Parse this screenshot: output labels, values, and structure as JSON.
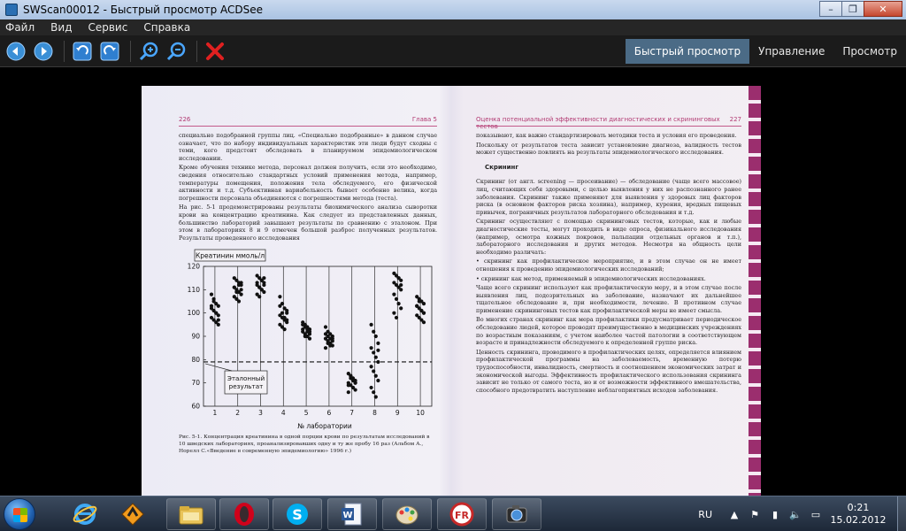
{
  "window": {
    "title": "SWScan00012 - Быстрый просмотр ACDSee",
    "minimize": "–",
    "restore": "❐",
    "close": "✕"
  },
  "menu": [
    "Файл",
    "Вид",
    "Сервис",
    "Справка"
  ],
  "toolbar": {
    "icons": [
      "back-arrow-icon",
      "forward-arrow-icon",
      "rotate-left-icon",
      "rotate-right-icon",
      "zoom-in-icon",
      "zoom-out-icon",
      "delete-icon"
    ]
  },
  "modes": [
    "Быстрый просмотр",
    "Управление",
    "Просмотр"
  ],
  "scan": {
    "left_page": {
      "page_number": "226",
      "chapter": "Глава 5",
      "paragraphs": [
        "специально подобранной группы лиц. «Специально подобранные» в данном случае означает, что по набору индивидуальных характеристик эти люди будут сходны с теми, кого предстоит обследовать в планируемом эпидемиологическом исследовании.",
        "Кроме обучения технике метода, персонал должен получить, если это необходимо, сведения относительно стандартных условий применения метода, например, температуры помещения, положения тела обследуемого, его физической активности и т.д. Субъективная вариабельность бывает особенно велика, когда погрешности персонала объединяются с погрешностями метода (теста).",
        "На рис. 5-1 продемонстрированы результаты биохимического анализа сыворотки крови на концентрацию креатинина. Как следует из представленных данных, большинство лабораторий завышают результаты по сравнению с эталоном. При этом в лабораториях 8 и 9 отмечен большой разброс полученных результатов. Результаты проведенного исследования"
      ],
      "caption": "Рис. 5-1. Концентрация креатинина в одной порции крови по результатам исследований в 10 шведских лабораториях, проанализировавших одну и ту же пробу 16 раз (Альбом А., Норелл С.«Введение в современную эпидемиологию» 1996 г.)"
    },
    "right_page": {
      "page_number": "227",
      "header": "Оценка потенциальной эффективности диагностических и скрининговых тестов",
      "intro": [
        "показывают, как важно стандартизировать методики теста и условия его проведения.",
        "Поскольку от результатов теста зависит установление диагноза, валидность тестов может существенно повлиять на результаты эпидемиологического исследования."
      ],
      "section_title": "Скрининг",
      "body": [
        "Скрининг (от англ. screening — просеивание) — обследование (чаще всего массовое) лиц, считающих себя здоровыми, с целью выявления у них не распознанного ранее заболевания. Скрининг также применяют для выявления у здоровых лиц факторов риска (в основном факторов риска хозяина), например, курения, вредных пищевых привычек, пограничных результатов лабораторного обследования и т.д.",
        "Скрининг осуществляют с помощью скрининговых тестов, которые, как и любые диагностические тесты, могут проходить в виде опроса, физикального исследования (например, осмотра кожных покровов, пальпации отдельных органов и т.п.), лабораторного исследования и других методов. Несмотря на общность цели необходимо различать:",
        "• скрининг как профилактическое мероприятие, и в этом случае он не имеет отношения к проведению эпидемиологических исследований;",
        "• скрининг как метод, применяемый в эпидемиологических исследованиях.",
        "Чаще всего скрининг используют как профилактическую меру, и в этом случае после выявления лиц, подозрительных на заболевание, назначают их дальнейшее тщательное обследование и, при необходимости, лечение. В противном случае применение скрининговых тестов как профилактической меры не имеет смысла.",
        "Во многих странах скрининг как мера профилактики предусматривает периодическое обследование людей, которое проводят преимущественно в медицинских учреждениях по возрастным показаниям, с учетом наиболее частой патологии в соответствующем возрасте и принадлежности обследуемого к определенной группе риска.",
        "Ценность скрининга, проводимого в профилактических целях, определяется влиянием профилактической программы на заболеваемость, временную потерю трудоспособности, инвалидность, смертность и соотношением экономических затрат и экономической выгоды. Эффективность профилактического использования скрининга зависит не только от самого теста, но и от возможности эффективного вмешательства, способного предотвратить наступление неблагоприятных исходов заболевания."
      ]
    }
  },
  "chart_data": {
    "type": "scatter",
    "ylabel": "Креатинин ммоль/л",
    "xlabel": "№ лаборатории",
    "ylim": [
      60,
      120
    ],
    "yticks": [
      60,
      70,
      80,
      90,
      100,
      110,
      120
    ],
    "categories": [
      "1",
      "2",
      "3",
      "4",
      "5",
      "6",
      "7",
      "8",
      "9",
      "10"
    ],
    "reference_value": 79,
    "reference_label": "Эталонный результат",
    "series": [
      {
        "values": [
          108,
          106,
          104,
          103,
          102,
          101,
          100,
          99,
          98,
          97,
          96,
          95,
          103,
          105,
          100,
          97
        ]
      },
      {
        "values": [
          115,
          114,
          113,
          112,
          111,
          110,
          109,
          108,
          107,
          106,
          105,
          113,
          111,
          109,
          112,
          110
        ]
      },
      {
        "values": [
          116,
          115,
          114,
          113,
          112,
          111,
          110,
          109,
          108,
          107,
          114,
          112,
          113,
          111,
          110,
          115
        ]
      },
      {
        "values": [
          107,
          104,
          102,
          100,
          99,
          98,
          97,
          96,
          95,
          94,
          93,
          101,
          103,
          100,
          98,
          97
        ]
      },
      {
        "values": [
          96,
          95,
          94,
          93,
          92,
          91,
          90,
          89,
          93,
          94,
          92,
          91,
          95,
          90,
          93,
          92
        ]
      },
      {
        "values": [
          94,
          92,
          91,
          90,
          89,
          88,
          87,
          86,
          85,
          90,
          89,
          88,
          91,
          87,
          86,
          89
        ]
      },
      {
        "values": [
          74,
          73,
          72,
          71,
          70,
          69,
          68,
          67,
          66,
          72,
          71,
          70,
          69,
          73,
          68,
          70
        ]
      },
      {
        "values": [
          95,
          92,
          90,
          87,
          85,
          83,
          81,
          79,
          77,
          75,
          73,
          71,
          68,
          66,
          64,
          84
        ]
      },
      {
        "values": [
          117,
          116,
          115,
          114,
          113,
          112,
          111,
          110,
          108,
          106,
          104,
          102,
          100,
          98,
          115,
          112
        ]
      },
      {
        "values": [
          107,
          106,
          105,
          104,
          103,
          102,
          101,
          100,
          99,
          98,
          97,
          96,
          103,
          105,
          101,
          100
        ]
      }
    ]
  },
  "taskbar": {
    "apps": [
      "internet-explorer-icon",
      "winamp-icon",
      "file-explorer-icon",
      "opera-icon",
      "skype-icon",
      "word-icon",
      "paint-icon",
      "finereader-icon",
      "acdsee-icon"
    ],
    "language": "RU",
    "time": "0:21",
    "date": "15.02.2012"
  },
  "colors": {
    "accent_tab": "#4b6b86",
    "menubar_bg": "#262626",
    "toolbar_bg": "#1b1b1b",
    "scan_running_head": "#b23a72"
  }
}
